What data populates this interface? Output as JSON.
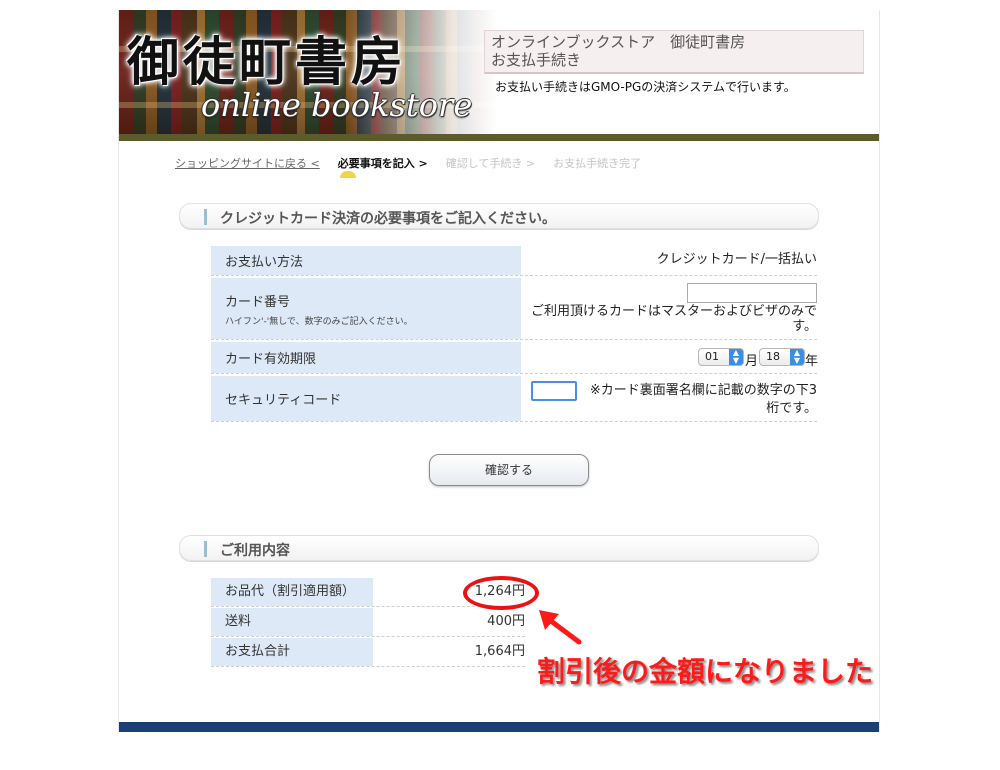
{
  "header": {
    "logo_title": "御徒町書房",
    "logo_subtitle": "online bookstore",
    "store_name": "オンラインブックストア　御徒町書房",
    "page_title": "お支払手続き",
    "note": "お支払い手続きはGMO-PGの決済システムで行います。"
  },
  "steps": {
    "back": "ショッピングサイトに戻る <",
    "current": "必要事項を記入 >",
    "confirm": "確認して手続き >",
    "complete": "お支払手続き完了"
  },
  "card_section": {
    "title": "クレジットカード決済の必要事項をご記入ください。",
    "payment_method_label": "お支払い方法",
    "payment_method_value": "クレジットカード/一括払い",
    "card_number_label": "カード番号",
    "card_number_hint": "ハイフン'-'無しで、数字のみご記入ください。",
    "card_number_value": "",
    "card_number_note": "ご利用頂けるカードはマスターおよびビザのみです。",
    "expiry_label": "カード有効期限",
    "expiry_month": "01",
    "expiry_month_unit": "月",
    "expiry_year": "18",
    "expiry_year_unit": "年",
    "security_label": "セキュリティコード",
    "security_value": "",
    "security_note": "※カード裏面署名欄に記載の数字の下3桁です。"
  },
  "confirm_button": "確認する",
  "usage_section": {
    "title": "ご利用内容",
    "rows": [
      {
        "label": "お品代（割引適用額）",
        "value": "1,264円"
      },
      {
        "label": "送料",
        "value": "400円"
      },
      {
        "label": "お支払合計",
        "value": "1,664円"
      }
    ]
  },
  "annotation": {
    "text": "割引後の金額になりました",
    "color": "#ff1a1a"
  }
}
